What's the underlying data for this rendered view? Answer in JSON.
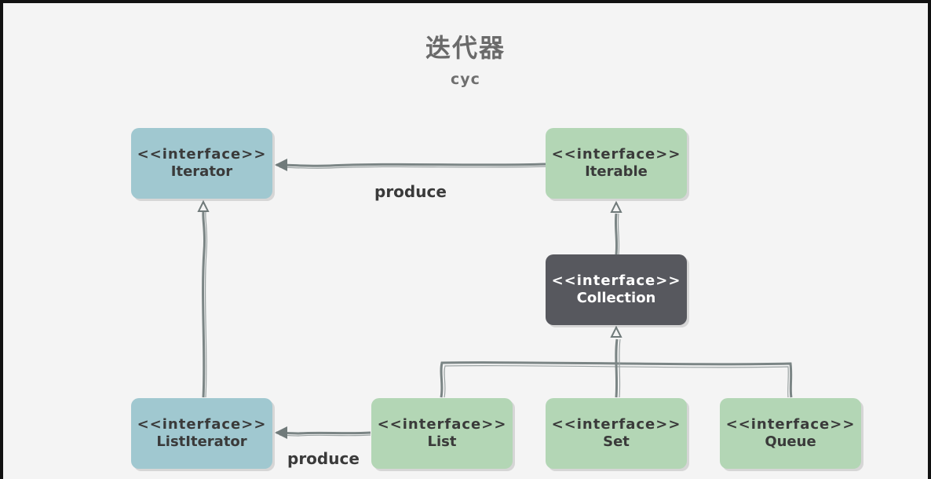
{
  "title": "迭代器",
  "subtitle": "cyc",
  "nodes": {
    "iterator": {
      "stereotype": "<<interface>>",
      "name": "Iterator"
    },
    "iterable": {
      "stereotype": "<<interface>>",
      "name": "Iterable"
    },
    "collection": {
      "stereotype": "<<interface>>",
      "name": "Collection"
    },
    "listiterator": {
      "stereotype": "<<interface>>",
      "name": "ListIterator"
    },
    "list": {
      "stereotype": "<<interface>>",
      "name": "List"
    },
    "set": {
      "stereotype": "<<interface>>",
      "name": "Set"
    },
    "queue": {
      "stereotype": "<<interface>>",
      "name": "Queue"
    }
  },
  "edges": {
    "iterable_produces_iterator": "produce",
    "list_produces_listiterator": "produce"
  },
  "colors": {
    "iterator_fill": "#a0c8d0",
    "collection_fill": "#b3d6b5",
    "collection_root_fill": "#57585e",
    "edge": "#7b8585"
  }
}
